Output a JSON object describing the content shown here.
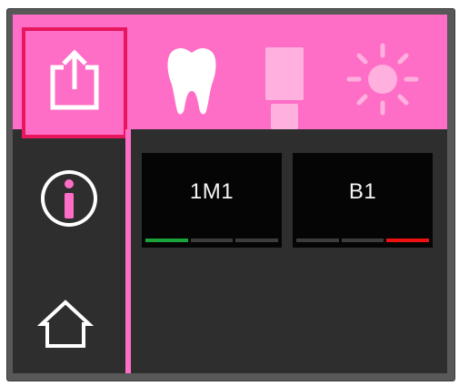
{
  "colors": {
    "accent": "#ff6ec6",
    "selection_border": "#e8165e",
    "background": "#2e2e2e",
    "card": "#050505",
    "indicator_on_left": "#1aa33a",
    "indicator_on_right": "#ee1111",
    "indicator_off": "#3c3c3c"
  },
  "toolbar": {
    "share": {
      "icon": "share-icon",
      "selected": true
    },
    "modes": [
      {
        "icon": "tooth-icon",
        "active": true
      },
      {
        "icon": "shade-tab-icon",
        "active": false
      },
      {
        "icon": "brightness-icon",
        "active": false
      }
    ]
  },
  "sidebar": {
    "items": [
      {
        "icon": "info-icon"
      },
      {
        "icon": "home-icon"
      }
    ]
  },
  "shades": [
    {
      "label": "1M1",
      "indicator_active_segment": 0
    },
    {
      "label": "B1",
      "indicator_active_segment": 2
    }
  ]
}
